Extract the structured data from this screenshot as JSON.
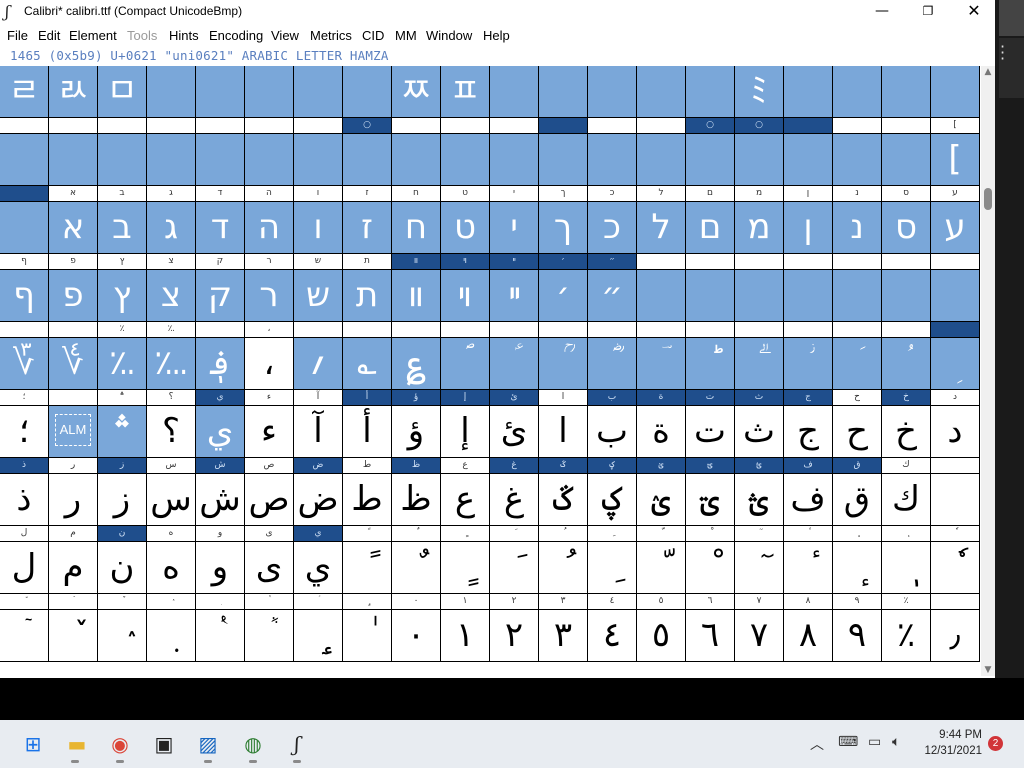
{
  "window": {
    "title": "Calibri*  calibri.ttf (Compact UnicodeBmp)",
    "app_icon": "fontforge-icon"
  },
  "menu": {
    "items": [
      {
        "label": "File",
        "enabled": true
      },
      {
        "label": "Edit",
        "enabled": true
      },
      {
        "label": "Element",
        "enabled": true
      },
      {
        "label": "Tools",
        "enabled": false
      },
      {
        "label": "Hints",
        "enabled": true
      },
      {
        "label": "Encoding",
        "enabled": true
      },
      {
        "label": "View",
        "enabled": true
      },
      {
        "label": "Metrics",
        "enabled": true
      },
      {
        "label": "CID",
        "enabled": true
      },
      {
        "label": "MM",
        "enabled": true
      },
      {
        "label": "Window",
        "enabled": true
      },
      {
        "label": "Help",
        "enabled": true
      }
    ]
  },
  "status": {
    "glyph_info": "1465 (0x5b9) U+0621 \"uni0621\" ARABIC LETTER HAMZA"
  },
  "glyph_grid": {
    "columns": 20,
    "rows": [
      {
        "headers": [
          "",
          "",
          "",
          "",
          "",
          "",
          "",
          "",
          "",
          "",
          "",
          "",
          "",
          "",
          "",
          "",
          "",
          "",
          "",
          ""
        ],
        "glyphs": [
          "ﾩ",
          "ﾭ",
          "ﾱ",
          "",
          "",
          "",
          "",
          "",
          "ﾹ",
          "ﾽ",
          "",
          "",
          "",
          "",
          "",
          "ﾐ",
          "",
          "",
          "",
          ""
        ],
        "sel": [
          1,
          1,
          1,
          1,
          1,
          1,
          1,
          1,
          1,
          1,
          1,
          1,
          1,
          1,
          1,
          1,
          1,
          1,
          1,
          1
        ],
        "hsel": [
          0,
          0,
          0,
          0,
          0,
          1,
          0,
          0,
          0,
          0,
          0,
          1,
          0,
          0,
          1,
          1,
          0,
          0,
          0,
          0
        ]
      },
      {
        "headers": [
          "",
          "",
          "",
          "",
          "",
          "",
          "",
          "○",
          "",
          "",
          "",
          "",
          "",
          "",
          "○",
          "○",
          "",
          "",
          "",
          "["
        ],
        "glyphs": [
          "",
          "",
          "",
          "",
          "",
          "",
          "",
          "",
          "",
          "",
          "",
          "",
          "",
          "",
          "",
          "",
          "",
          "",
          "",
          "["
        ],
        "sel": [
          1,
          1,
          1,
          1,
          1,
          1,
          1,
          1,
          1,
          1,
          1,
          1,
          1,
          1,
          1,
          1,
          1,
          1,
          1,
          1
        ],
        "hsel": [
          0,
          0,
          0,
          0,
          0,
          0,
          0,
          1,
          0,
          0,
          0,
          1,
          0,
          0,
          1,
          1,
          1,
          0,
          0,
          0
        ]
      },
      {
        "headers": [
          "",
          "א",
          "ב",
          "ג",
          "ד",
          "ה",
          "ו",
          "ז",
          "ח",
          "ט",
          "י",
          "ך",
          "כ",
          "ל",
          "ם",
          "מ",
          "ן",
          "נ",
          "ס",
          "ע"
        ],
        "glyphs": [
          "",
          "א",
          "ב",
          "ג",
          "ד",
          "ה",
          "ו",
          "ז",
          "ח",
          "ט",
          "י",
          "ך",
          "כ",
          "ל",
          "ם",
          "מ",
          "ן",
          "נ",
          "ס",
          "ע"
        ],
        "sel": [
          1,
          1,
          1,
          1,
          1,
          1,
          1,
          1,
          1,
          1,
          1,
          1,
          1,
          1,
          1,
          1,
          1,
          1,
          1,
          1
        ],
        "hsel": [
          1,
          0,
          0,
          0,
          0,
          0,
          0,
          0,
          0,
          0,
          0,
          0,
          0,
          0,
          0,
          0,
          0,
          0,
          0,
          0
        ]
      },
      {
        "headers": [
          "ף",
          "פ",
          "ץ",
          "צ",
          "ק",
          "ר",
          "ש",
          "ת",
          "װ",
          "ױ",
          "ײ",
          "׳",
          "״",
          "",
          "",
          "",
          "",
          "",
          "",
          ""
        ],
        "glyphs": [
          "ף",
          "פ",
          "ץ",
          "צ",
          "ק",
          "ר",
          "ש",
          "ת",
          "װ",
          "ױ",
          "ײ",
          "׳",
          "״",
          "",
          "",
          "",
          "",
          "",
          "",
          ""
        ],
        "sel": [
          1,
          1,
          1,
          1,
          1,
          1,
          1,
          1,
          1,
          1,
          1,
          1,
          1,
          1,
          1,
          1,
          1,
          1,
          1,
          1
        ],
        "hsel": [
          0,
          0,
          0,
          0,
          0,
          0,
          0,
          0,
          1,
          1,
          1,
          1,
          1,
          0,
          0,
          0,
          0,
          0,
          0,
          0
        ]
      },
      {
        "headers": [
          "",
          "",
          "٪",
          "؉",
          "",
          "،",
          "",
          "",
          "",
          "",
          "",
          "",
          "",
          "",
          "",
          "",
          "",
          "",
          "",
          ""
        ],
        "glyphs": [
          "؆",
          "؇",
          "؉",
          "؊",
          "؋",
          "،",
          "؍",
          "؎",
          "؏",
          "ؐ",
          "ؑ",
          "ؒ",
          "ؓ",
          "ؔ",
          "ؕ",
          "ؖ",
          "ؗ",
          "ؘ",
          "ؙ",
          "ؚ"
        ],
        "sel": [
          1,
          1,
          1,
          1,
          1,
          0,
          1,
          1,
          1,
          1,
          1,
          1,
          1,
          1,
          1,
          1,
          1,
          1,
          1,
          1
        ],
        "hsel": [
          0,
          0,
          0,
          0,
          0,
          0,
          0,
          0,
          0,
          0,
          0,
          0,
          0,
          0,
          0,
          0,
          0,
          0,
          0,
          1
        ]
      },
      {
        "headers": [
          "؛",
          "",
          "؞",
          "؟",
          "ي",
          "ء",
          "آ",
          "أ",
          "ؤ",
          "إ",
          "ئ",
          "ا",
          "ب",
          "ة",
          "ت",
          "ث",
          "ج",
          "ح",
          "خ",
          "د"
        ],
        "glyphs": [
          "؛",
          "ALM",
          "؞",
          "؟",
          "ي",
          "ء",
          "آ",
          "أ",
          "ؤ",
          "إ",
          "ئ",
          "ا",
          "ب",
          "ة",
          "ت",
          "ث",
          "ج",
          "ح",
          "خ",
          "د"
        ],
        "sel": [
          0,
          1,
          1,
          0,
          1,
          0,
          0,
          0,
          0,
          0,
          0,
          0,
          0,
          0,
          0,
          0,
          0,
          0,
          0,
          0
        ],
        "hsel": [
          0,
          0,
          0,
          0,
          1,
          0,
          0,
          1,
          1,
          1,
          1,
          0,
          1,
          1,
          1,
          1,
          1,
          0,
          1,
          0
        ]
      },
      {
        "headers": [
          "ذ",
          "ر",
          "ز",
          "س",
          "ش",
          "ص",
          "ض",
          "ط",
          "ظ",
          "ع",
          "غ",
          "ػ",
          "ؼ",
          "ؽ",
          "ؾ",
          "ؿ",
          "ف",
          "ق",
          "ك",
          ""
        ],
        "glyphs": [
          "ذ",
          "ر",
          "ز",
          "س",
          "ش",
          "ص",
          "ض",
          "ط",
          "ظ",
          "ع",
          "غ",
          "ػ",
          "ؼ",
          "ؽ",
          "ؾ",
          "ؿ",
          "ف",
          "ق",
          "ك",
          ""
        ],
        "sel": [
          0,
          0,
          0,
          0,
          0,
          0,
          0,
          0,
          0,
          0,
          0,
          0,
          0,
          0,
          0,
          0,
          0,
          0,
          0,
          0
        ],
        "hsel": [
          1,
          0,
          1,
          0,
          1,
          0,
          1,
          0,
          1,
          0,
          1,
          1,
          1,
          1,
          1,
          1,
          1,
          1,
          0,
          0
        ]
      },
      {
        "headers": [
          "ل",
          "م",
          "ن",
          "ه",
          "و",
          "ى",
          "ي",
          "ً",
          "ٌ",
          "ٍ",
          "َ",
          "ُ",
          "ِ",
          "ّ",
          "ْ",
          "ٓ",
          "ٔ",
          "ٕ",
          "ٖ",
          "ٗ"
        ],
        "glyphs": [
          "ل",
          "م",
          "ن",
          "ه",
          "و",
          "ى",
          "ي",
          "ً",
          "ٌ",
          "ٍ",
          "َ",
          "ُ",
          "ِ",
          "ّ",
          "ْ",
          "ٓ",
          "ٔ",
          "ٕ",
          "ٖ",
          "ٗ"
        ],
        "sel": [
          0,
          0,
          0,
          0,
          0,
          0,
          0,
          0,
          0,
          0,
          0,
          0,
          0,
          0,
          0,
          0,
          0,
          0,
          0,
          0
        ],
        "hsel": [
          0,
          0,
          1,
          0,
          0,
          0,
          1,
          0,
          0,
          0,
          0,
          0,
          0,
          0,
          0,
          0,
          0,
          0,
          0,
          0
        ]
      },
      {
        "headers": [
          "٘",
          "ٙ",
          "ٚ",
          "ٛ",
          "ٜ",
          "ٝ",
          "ٞ",
          "ٟ",
          "٠",
          "١",
          "٢",
          "٣",
          "٤",
          "٥",
          "٦",
          "٧",
          "٨",
          "٩",
          "٪",
          ""
        ],
        "glyphs": [
          "ٙ",
          "ٚ",
          "ٛ",
          "ٜ",
          "ٝ",
          "ٞ",
          "ٟ",
          "ٰ",
          "٠",
          "١",
          "٢",
          "٣",
          "٤",
          "٥",
          "٦",
          "٧",
          "٨",
          "٩",
          "٪",
          "٫"
        ],
        "sel": [
          0,
          0,
          0,
          0,
          0,
          0,
          0,
          0,
          0,
          0,
          0,
          0,
          0,
          0,
          0,
          0,
          0,
          0,
          0,
          0
        ],
        "hsel": [
          0,
          0,
          0,
          0,
          0,
          0,
          0,
          0,
          0,
          0,
          0,
          0,
          0,
          0,
          0,
          0,
          0,
          0,
          0,
          0
        ]
      }
    ]
  },
  "taskbar": {
    "apps": [
      "start-icon",
      "explorer-icon",
      "chrome-icon",
      "store-icon",
      "photos-icon",
      "maps-icon",
      "fontforge-icon"
    ],
    "clock_time": "9:44 PM",
    "clock_date": "12/31/2021",
    "notification_count": "2"
  },
  "colors": {
    "selected_glyph": "#7aa7d9",
    "selected_header": "#1f4e8c",
    "status_text": "#5a7fbf"
  }
}
